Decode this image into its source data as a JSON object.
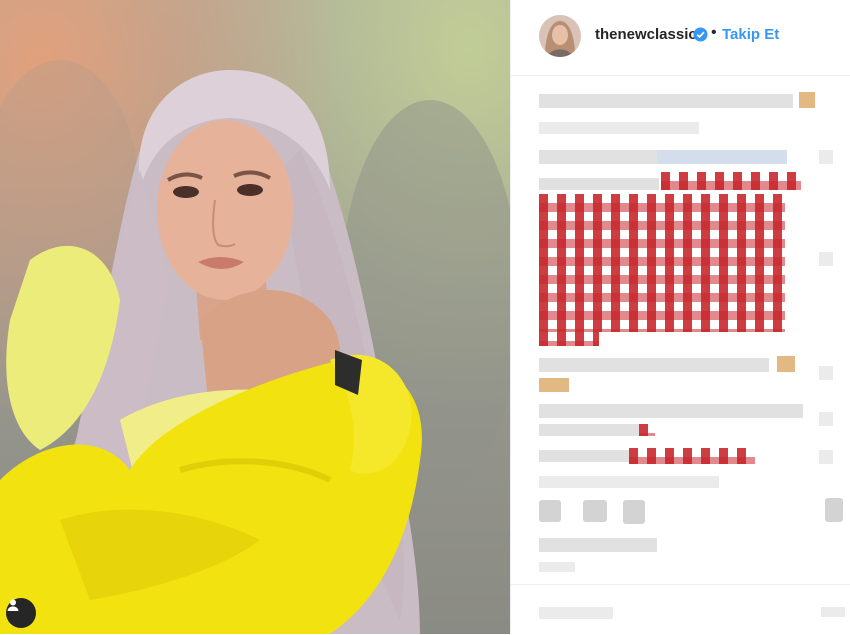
{
  "post": {
    "username": "thenewclassic",
    "follow_label": "Takip Et",
    "separator": "•",
    "verified": true
  },
  "icons": {
    "verified": "verified-badge-icon",
    "tagged_user": "user-tag-icon",
    "like": "heart-icon",
    "comment": "comment-icon",
    "share": "share-icon",
    "save": "bookmark-icon"
  },
  "colors": {
    "link_blue": "#3897f0",
    "text": "#262626",
    "border": "#efefef",
    "coat_yellow": "#f2e20f"
  }
}
